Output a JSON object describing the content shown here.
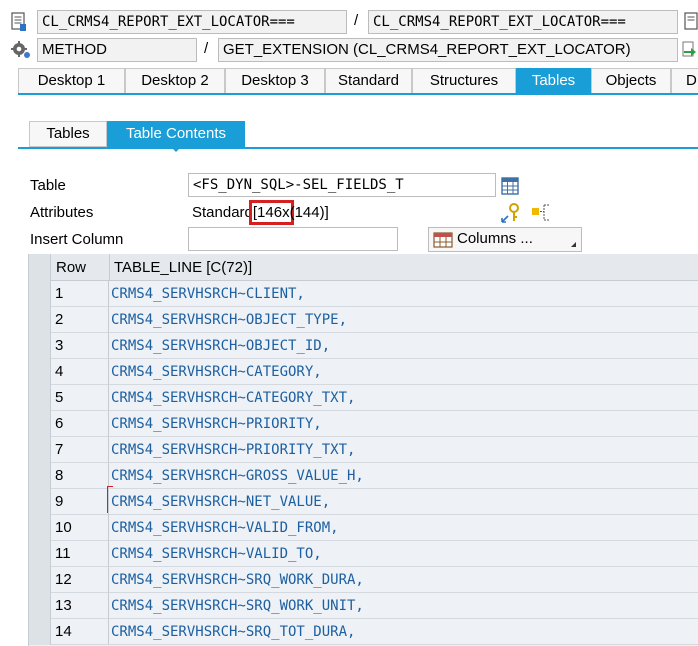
{
  "header": {
    "object1": "CL_CRMS4_REPORT_EXT_LOCATOR===",
    "object2": "CL_CRMS4_REPORT_EXT_LOCATOR===",
    "type": "METHOD",
    "method": "GET_EXTENSION (CL_CRMS4_REPORT_EXT_LOCATOR)",
    "sep1": "/",
    "sep2": "/"
  },
  "tabs": [
    {
      "label": "Desktop 1"
    },
    {
      "label": "Desktop 2"
    },
    {
      "label": "Desktop 3"
    },
    {
      "label": "Standard"
    },
    {
      "label": "Structures"
    },
    {
      "label": "Tables"
    },
    {
      "label": "Objects"
    },
    {
      "label": "D"
    }
  ],
  "active_tab": "Tables",
  "subtabs": [
    {
      "label": "Tables"
    },
    {
      "label": "Table Contents"
    }
  ],
  "active_subtab": "Table Contents",
  "form": {
    "table_label": "Table",
    "table_value": "<FS_DYN_SQL>-SEL_FIELDS_T",
    "attributes_label": "Attributes",
    "attributes_prefix": "Standard",
    "attributes_highlight": "[146x",
    "attributes_suffix": "(144)]",
    "insert_column_label": "Insert Column",
    "insert_column_value": "",
    "columns_button": "Columns ..."
  },
  "grid": {
    "headers": [
      "Row",
      "TABLE_LINE [C(72)]"
    ],
    "rows": [
      {
        "row": "1",
        "value": "CRMS4_SERVHSRCH~CLIENT,"
      },
      {
        "row": "2",
        "value": "CRMS4_SERVHSRCH~OBJECT_TYPE,"
      },
      {
        "row": "3",
        "value": "CRMS4_SERVHSRCH~OBJECT_ID,"
      },
      {
        "row": "4",
        "value": "CRMS4_SERVHSRCH~CATEGORY,"
      },
      {
        "row": "5",
        "value": "CRMS4_SERVHSRCH~CATEGORY_TXT,"
      },
      {
        "row": "6",
        "value": "CRMS4_SERVHSRCH~PRIORITY,"
      },
      {
        "row": "7",
        "value": "CRMS4_SERVHSRCH~PRIORITY_TXT,"
      },
      {
        "row": "8",
        "value": "CRMS4_SERVHSRCH~GROSS_VALUE_H,"
      },
      {
        "row": "9",
        "value": "CRMS4_SERVHSRCH~NET_VALUE,"
      },
      {
        "row": "10",
        "value": "CRMS4_SERVHSRCH~VALID_FROM,"
      },
      {
        "row": "11",
        "value": "CRMS4_SERVHSRCH~VALID_TO,"
      },
      {
        "row": "12",
        "value": "CRMS4_SERVHSRCH~SRQ_WORK_DURA,"
      },
      {
        "row": "13",
        "value": "CRMS4_SERVHSRCH~SRQ_WORK_UNIT,"
      },
      {
        "row": "14",
        "value": "CRMS4_SERVHSRCH~SRQ_TOT_DURA,"
      }
    ]
  },
  "icons": {
    "doc": "document-icon",
    "gear": "gear-icon",
    "table": "table-view-icon",
    "key": "key-icon",
    "hierarchy": "hierarchy-icon",
    "grid_columns": "columns-icon",
    "dropdown": "dropdown-triangle-icon",
    "arrow": "green-arrow-icon"
  },
  "colors": {
    "accent": "#199ed8",
    "highlight_box": "#d42020",
    "grid_text": "#1d5fa0"
  }
}
